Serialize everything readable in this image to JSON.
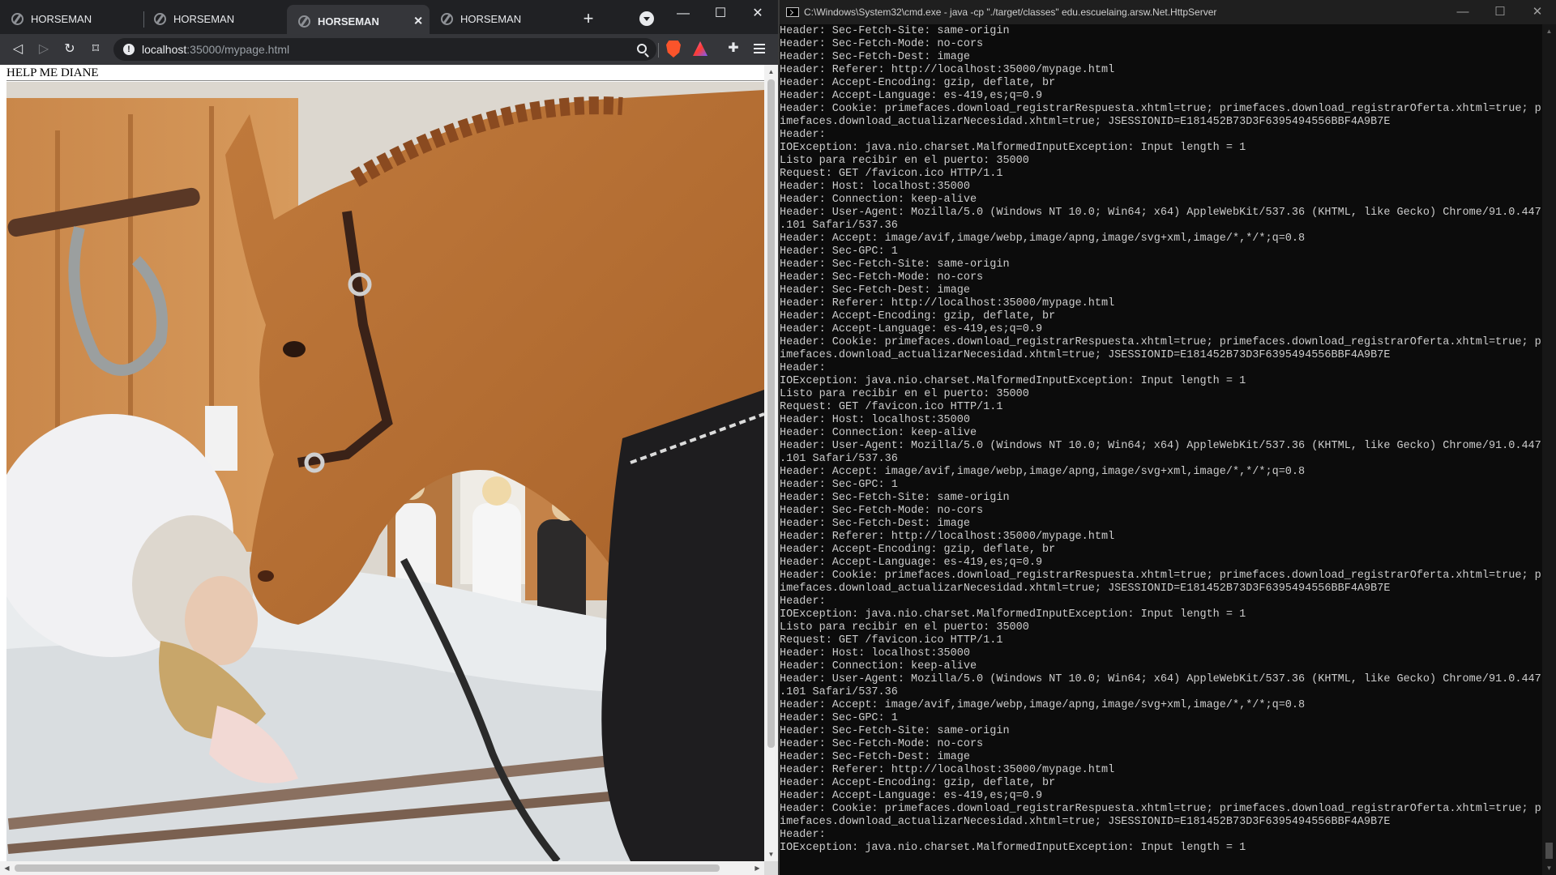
{
  "browser": {
    "tabs": [
      {
        "label": "HORSEMAN",
        "active": false
      },
      {
        "label": "HORSEMAN",
        "active": false
      },
      {
        "label": "HORSEMAN",
        "active": true
      },
      {
        "label": "HORSEMAN",
        "active": false
      }
    ],
    "address": {
      "host": "localhost",
      "rest": ":35000/mypage.html"
    },
    "page": {
      "heading": "HELP ME DIANE"
    },
    "colors": {
      "chrome_dark": "#202124",
      "chrome_toolbar": "#35363a",
      "page_bg": "#ffffff"
    }
  },
  "cmd": {
    "title": "C:\\Windows\\System32\\cmd.exe - java  -cp \"./target/classes\" edu.escuelaing.arsw.Net.HttpServer",
    "lines": [
      "Header: Sec-Fetch-Site: same-origin",
      "Header: Sec-Fetch-Mode: no-cors",
      "Header: Sec-Fetch-Dest: image",
      "Header: Referer: http://localhost:35000/mypage.html",
      "Header: Accept-Encoding: gzip, deflate, br",
      "Header: Accept-Language: es-419,es;q=0.9",
      "Header: Cookie: primefaces.download_registrarRespuesta.xhtml=true; primefaces.download_registrarOferta.xhtml=true; pr",
      "imefaces.download_actualizarNecesidad.xhtml=true; JSESSIONID=E181452B73D3F6395494556BBF4A9B7E",
      "Header:",
      "IOException: java.nio.charset.MalformedInputException: Input length = 1",
      "Listo para recibir en el puerto: 35000",
      "Request: GET /favicon.ico HTTP/1.1",
      "Header: Host: localhost:35000",
      "Header: Connection: keep-alive",
      "Header: User-Agent: Mozilla/5.0 (Windows NT 10.0; Win64; x64) AppleWebKit/537.36 (KHTML, like Gecko) Chrome/91.0.4472",
      ".101 Safari/537.36",
      "Header: Accept: image/avif,image/webp,image/apng,image/svg+xml,image/*,*/*;q=0.8",
      "Header: Sec-GPC: 1",
      "Header: Sec-Fetch-Site: same-origin",
      "Header: Sec-Fetch-Mode: no-cors",
      "Header: Sec-Fetch-Dest: image",
      "Header: Referer: http://localhost:35000/mypage.html",
      "Header: Accept-Encoding: gzip, deflate, br",
      "Header: Accept-Language: es-419,es;q=0.9",
      "Header: Cookie: primefaces.download_registrarRespuesta.xhtml=true; primefaces.download_registrarOferta.xhtml=true; pr",
      "imefaces.download_actualizarNecesidad.xhtml=true; JSESSIONID=E181452B73D3F6395494556BBF4A9B7E",
      "Header:",
      "IOException: java.nio.charset.MalformedInputException: Input length = 1",
      "Listo para recibir en el puerto: 35000",
      "Request: GET /favicon.ico HTTP/1.1",
      "Header: Host: localhost:35000",
      "Header: Connection: keep-alive",
      "Header: User-Agent: Mozilla/5.0 (Windows NT 10.0; Win64; x64) AppleWebKit/537.36 (KHTML, like Gecko) Chrome/91.0.4472",
      ".101 Safari/537.36",
      "Header: Accept: image/avif,image/webp,image/apng,image/svg+xml,image/*,*/*;q=0.8",
      "Header: Sec-GPC: 1",
      "Header: Sec-Fetch-Site: same-origin",
      "Header: Sec-Fetch-Mode: no-cors",
      "Header: Sec-Fetch-Dest: image",
      "Header: Referer: http://localhost:35000/mypage.html",
      "Header: Accept-Encoding: gzip, deflate, br",
      "Header: Accept-Language: es-419,es;q=0.9",
      "Header: Cookie: primefaces.download_registrarRespuesta.xhtml=true; primefaces.download_registrarOferta.xhtml=true; pr",
      "imefaces.download_actualizarNecesidad.xhtml=true; JSESSIONID=E181452B73D3F6395494556BBF4A9B7E",
      "Header:",
      "IOException: java.nio.charset.MalformedInputException: Input length = 1",
      "Listo para recibir en el puerto: 35000",
      "Request: GET /favicon.ico HTTP/1.1",
      "Header: Host: localhost:35000",
      "Header: Connection: keep-alive",
      "Header: User-Agent: Mozilla/5.0 (Windows NT 10.0; Win64; x64) AppleWebKit/537.36 (KHTML, like Gecko) Chrome/91.0.4472",
      ".101 Safari/537.36",
      "Header: Accept: image/avif,image/webp,image/apng,image/svg+xml,image/*,*/*;q=0.8",
      "Header: Sec-GPC: 1",
      "Header: Sec-Fetch-Site: same-origin",
      "Header: Sec-Fetch-Mode: no-cors",
      "Header: Sec-Fetch-Dest: image",
      "Header: Referer: http://localhost:35000/mypage.html",
      "Header: Accept-Encoding: gzip, deflate, br",
      "Header: Accept-Language: es-419,es;q=0.9",
      "Header: Cookie: primefaces.download_registrarRespuesta.xhtml=true; primefaces.download_registrarOferta.xhtml=true; pr",
      "imefaces.download_actualizarNecesidad.xhtml=true; JSESSIONID=E181452B73D3F6395494556BBF4A9B7E",
      "Header:",
      "IOException: java.nio.charset.MalformedInputException: Input length = 1"
    ],
    "colors": {
      "bg": "#0c0c0c",
      "text": "#cccccc",
      "titlebar": "#1f1f1f"
    }
  }
}
